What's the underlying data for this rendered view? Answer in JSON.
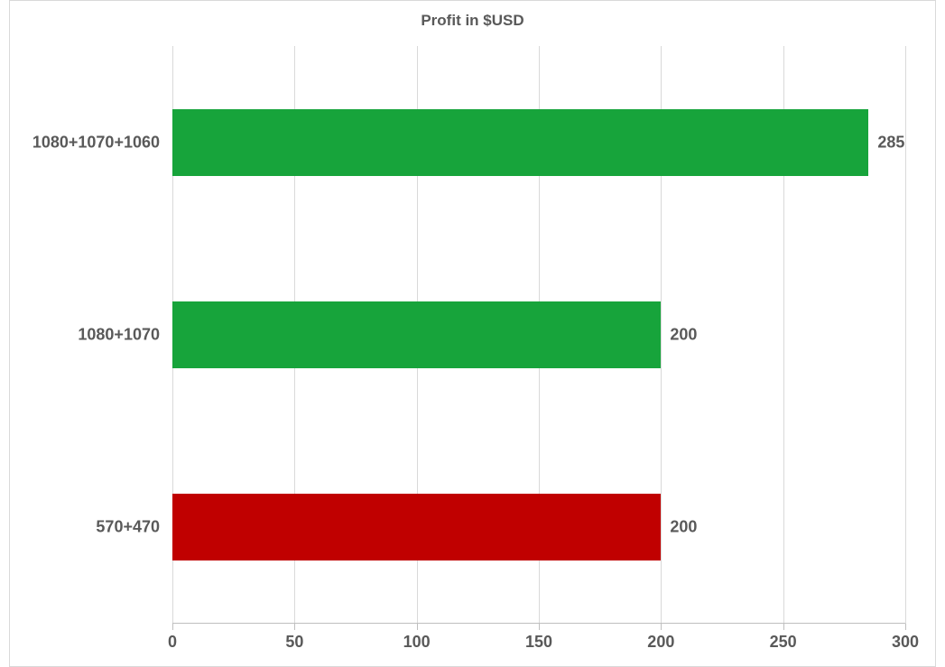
{
  "chart_data": {
    "type": "bar",
    "orientation": "horizontal",
    "title": "Profit in $USD",
    "xlabel": "",
    "ylabel": "",
    "xlim": [
      0,
      300
    ],
    "x_ticks": [
      0,
      50,
      100,
      150,
      200,
      250,
      300
    ],
    "categories": [
      "570+470",
      "1080+1070",
      "1080+1070+1060"
    ],
    "values": [
      200,
      200,
      285
    ],
    "colors": [
      "#c00000",
      "#17a43b",
      "#17a43b"
    ]
  }
}
